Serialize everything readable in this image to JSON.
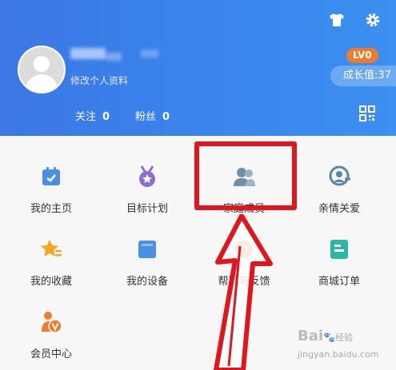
{
  "profile": {
    "edit_label": "修改个人资料",
    "level": "LV0",
    "growth": "成长值:37",
    "following_label": "关注",
    "following_count": "0",
    "fans_label": "粉丝",
    "fans_count": "0"
  },
  "icons": {
    "shirt": "shirt-icon",
    "settings": "gear-icon",
    "qr": "qr-code-icon"
  },
  "menu": [
    {
      "label": "我的主页",
      "icon": "calendar-icon",
      "color": "#4a90e2"
    },
    {
      "label": "目标计划",
      "icon": "medal-icon",
      "color": "#8b6fd1"
    },
    {
      "label": "家庭成员",
      "icon": "family-icon",
      "color": "#6f8fa8"
    },
    {
      "label": "亲情关爱",
      "icon": "care-icon",
      "color": "#5b86a6"
    },
    {
      "label": "我的收藏",
      "icon": "star-icon",
      "color": "#f5a623"
    },
    {
      "label": "我的设备",
      "icon": "device-icon",
      "color": "#4a90e2"
    },
    {
      "label": "帮助与反馈",
      "icon": "help-icon",
      "color": "#f07b2a"
    },
    {
      "label": "商城订单",
      "icon": "order-icon",
      "color": "#2cb8a0"
    },
    {
      "label": "会员中心",
      "icon": "vip-icon",
      "color": "#f07b2a"
    }
  ],
  "watermark": {
    "brand": "Bai",
    "sub": "经验",
    "domain": "jingyan.baidu.com"
  },
  "colors": {
    "header": "#3a86ee",
    "highlight": "#e2141c"
  }
}
